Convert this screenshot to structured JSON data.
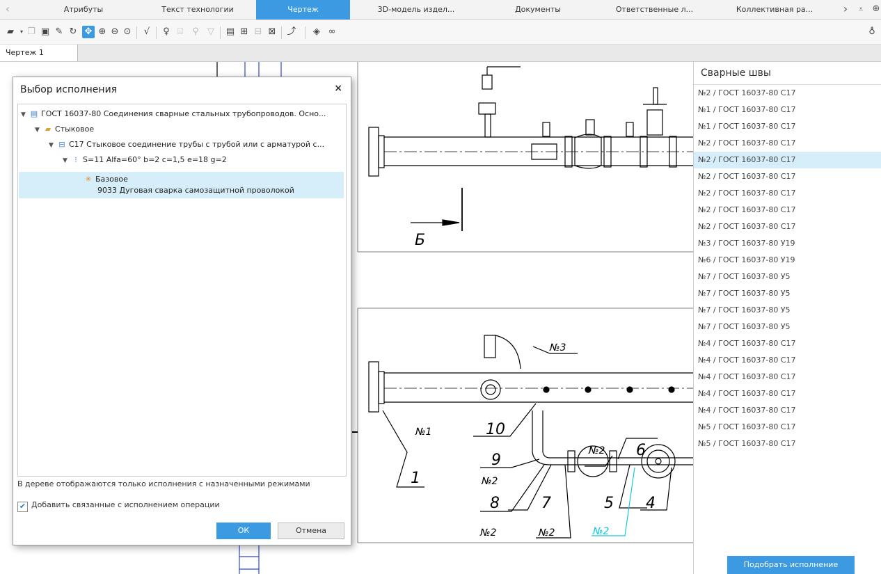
{
  "tabs": [
    {
      "label": "Атрибуты"
    },
    {
      "label": "Текст технологии"
    },
    {
      "label": "Чертеж"
    },
    {
      "label": "3D-модель издел..."
    },
    {
      "label": "Документы"
    },
    {
      "label": "Ответственные л..."
    },
    {
      "label": "Коллективная ра..."
    }
  ],
  "document_tab": "Чертеж 1",
  "drawing": {
    "section_label": "Б",
    "callouts": [
      "№3",
      "№1",
      "10",
      "1",
      "№2",
      "6",
      "9",
      "№2",
      "8",
      "7",
      "5",
      "4",
      "№2",
      "№2",
      "№2"
    ]
  },
  "welds_panel": {
    "title": "Сварные швы",
    "items": [
      "№2 / ГОСТ 16037-80 С17",
      "№1 / ГОСТ 16037-80 С17",
      "№1 / ГОСТ 16037-80 С17",
      "№2 / ГОСТ 16037-80 С17",
      "№2 / ГОСТ 16037-80 С17",
      "№2 / ГОСТ 16037-80 С17",
      "№2 / ГОСТ 16037-80 С17",
      "№2 / ГОСТ 16037-80 С17",
      "№2 / ГОСТ 16037-80 С17",
      "№3 / ГОСТ 16037-80 У19",
      "№6 / ГОСТ 16037-80 У19",
      "№7 / ГОСТ 16037-80 У5",
      "№7 / ГОСТ 16037-80 У5",
      "№7 / ГОСТ 16037-80 У5",
      "№7 / ГОСТ 16037-80 У5",
      "№4 / ГОСТ 16037-80 С17",
      "№4 / ГОСТ 16037-80 С17",
      "№4 / ГОСТ 16037-80 С17",
      "№4 / ГОСТ 16037-80 С17",
      "№4 / ГОСТ 16037-80 С17",
      "№5 / ГОСТ 16037-80 С17",
      "№5 / ГОСТ 16037-80 С17"
    ],
    "selected_index": 4,
    "pick_button": "Подобрать исполнение"
  },
  "dialog": {
    "title": "Выбор исполнения",
    "close": "×",
    "tree": {
      "n1": "ГОСТ 16037-80 Соединения сварные стальных трубопроводов. Осно...",
      "n2": "Стыковое",
      "n3": "С17 Стыковое соединение трубы с трубой или с арматурой с...",
      "n4": "S=11 Alfa=60° b=2 c=1,5 e=18 g=2",
      "n5a": "Базовое",
      "n5b": "9033 Дуговая сварка самозащитной проволокой"
    },
    "note": "В дереве отображаются только исполнения с назначенными режимами",
    "checkbox_label": "Добавить связанные с исполнением операции",
    "checkbox_checked": true,
    "ok": "ОК",
    "cancel": "Отмена"
  }
}
